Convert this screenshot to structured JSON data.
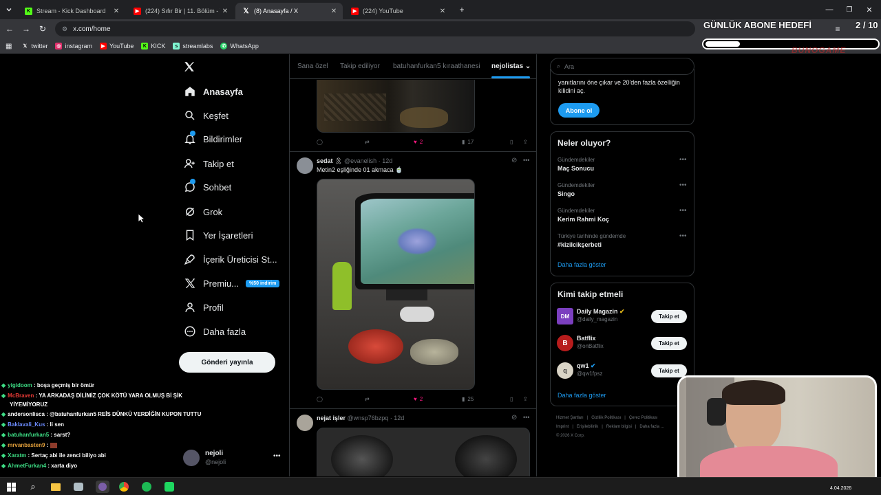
{
  "browser": {
    "tabs": [
      {
        "title": "Stream - Kick Dashboard",
        "icon": "kick-icon"
      },
      {
        "title": "(224) Sıfır Bir | 11. Bölüm - YouTube",
        "icon": "youtube-icon"
      },
      {
        "title": "(8) Anasayfa / X",
        "icon": "x-icon"
      },
      {
        "title": "(224) YouTube",
        "icon": "youtube-icon"
      }
    ],
    "url": "x.com/home",
    "bookmarks": [
      "twitter",
      "instagram",
      "YouTube",
      "KICK",
      "streamlabs",
      "WhatsApp"
    ]
  },
  "overlay": {
    "goal_title": "GÜNLÜK ABONE HEDEFİ",
    "goal_count": "2 / 10",
    "goal_progress": 0.2,
    "brand_watermark": "BUNOGAME"
  },
  "sidebar": {
    "items": [
      {
        "label": "Anasayfa",
        "icon": "home-icon"
      },
      {
        "label": "Keşfet",
        "icon": "search-icon"
      },
      {
        "label": "Bildirimler",
        "icon": "bell-icon"
      },
      {
        "label": "Takip et",
        "icon": "follow-icon"
      },
      {
        "label": "Sohbet",
        "icon": "chat-icon"
      },
      {
        "label": "Grok",
        "icon": "grok-icon"
      },
      {
        "label": "Yer İşaretleri",
        "icon": "bookmark-icon"
      },
      {
        "label": "İçerik Üreticisi St...",
        "icon": "rocket-icon"
      },
      {
        "label": "Premiu...",
        "icon": "x-icon"
      },
      {
        "label": "Profil",
        "icon": "person-icon"
      },
      {
        "label": "Daha fazla",
        "icon": "more-circle-icon"
      }
    ],
    "premium_badge": "%50 indirim",
    "post_button": "Gönderi yayınla",
    "account": {
      "name": "nejoli",
      "handle": "@nejoli"
    }
  },
  "feed": {
    "tabs": [
      "Sana özel",
      "Takip ediliyor",
      "batuhanfurkan5 kıraathanesi",
      "nejolistas"
    ],
    "top_post_actions": {
      "likes": "2",
      "views": "17"
    },
    "posts": [
      {
        "name": "sedat",
        "handle": "@evanelish",
        "time": "12d",
        "text": "Metin2 eşliğinde 01 akmaca",
        "likes": "2",
        "views": "25"
      },
      {
        "name": "nejat işler",
        "handle": "@wnsp76bzpq",
        "time": "12d",
        "text": ""
      }
    ]
  },
  "right": {
    "search_placeholder": "Ara",
    "premium_text": "yanıtlarını öne çıkar ve 20'den fazla özelliğin kilidini aç.",
    "premium_button": "Abone ol",
    "trends_title": "Neler oluyor?",
    "trends": [
      {
        "context": "Gündemdekiler",
        "name": "Maç Sonucu"
      },
      {
        "context": "Gündemdekiler",
        "name": "Singo"
      },
      {
        "context": "Gündemdekiler",
        "name": "Kerim Rahmi Koç"
      },
      {
        "context": "Türkiye tarihinde gündemde",
        "name": "#kizilcikşerbeti"
      }
    ],
    "show_more": "Daha fazla göster",
    "who_to_follow_title": "Kimi takip etmeli",
    "follow": [
      {
        "name": "Daily Magazin",
        "handle": "@daily_magazin",
        "avatar": "DM"
      },
      {
        "name": "Batflix",
        "handle": "@onBatflix",
        "avatar": "B"
      },
      {
        "name": "qw1",
        "handle": "@qw1fpsz",
        "avatar": "q"
      }
    ],
    "follow_button": "Takip et",
    "follow_show_more": "Daha fazla göster",
    "footer": [
      "Hizmet Şartları",
      "Gizlilik Politikası",
      "Çerez Politikası",
      "Imprint",
      "Erişilebilirlik",
      "Reklam bilgisi",
      "Daha fazla ...",
      "© 2026 X Corp."
    ]
  },
  "chat": [
    {
      "user": "yigidoom",
      "msg": ": boşa geçmiş bir ömür",
      "color": "#3ddc84"
    },
    {
      "user": "McBraven",
      "msg": ": YA ARKADAŞ DİLİMİZ ÇOK KÖTÜ YARA OLMUŞ Bİ ŞİK",
      "color": "#e53935"
    },
    {
      "user": "",
      "msg": "YİYEMİYORUZ",
      "color": "#ffffff"
    },
    {
      "user": "andersonlisca",
      "msg": ": @batuhanfurkan5 REİS DÜNKÜ VERDİĞİN KUPON TUTTU",
      "color": "#ffffff"
    },
    {
      "user": "Baklavali_Kus",
      "msg": ": li sen",
      "color": "#6c8cff"
    },
    {
      "user": "batuhanfurkan5",
      "msg": ": sarst?",
      "color": "#3ddc84"
    },
    {
      "user": "mrvanbasten9",
      "msg": ":",
      "color": "#e6a23c"
    },
    {
      "user": "Xaratm",
      "msg": ": Sertaç abi ile zenci biliyo abi",
      "color": "#3ddc84"
    },
    {
      "user": "AhmetFurkan4",
      "msg": ": xarta diyo",
      "color": "#3ddc84"
    }
  ],
  "taskbar": {
    "date": "4.04.2026"
  },
  "colors": {
    "accent": "#1d9bf0",
    "like": "#f91880",
    "premium": "#1d9bf0"
  }
}
